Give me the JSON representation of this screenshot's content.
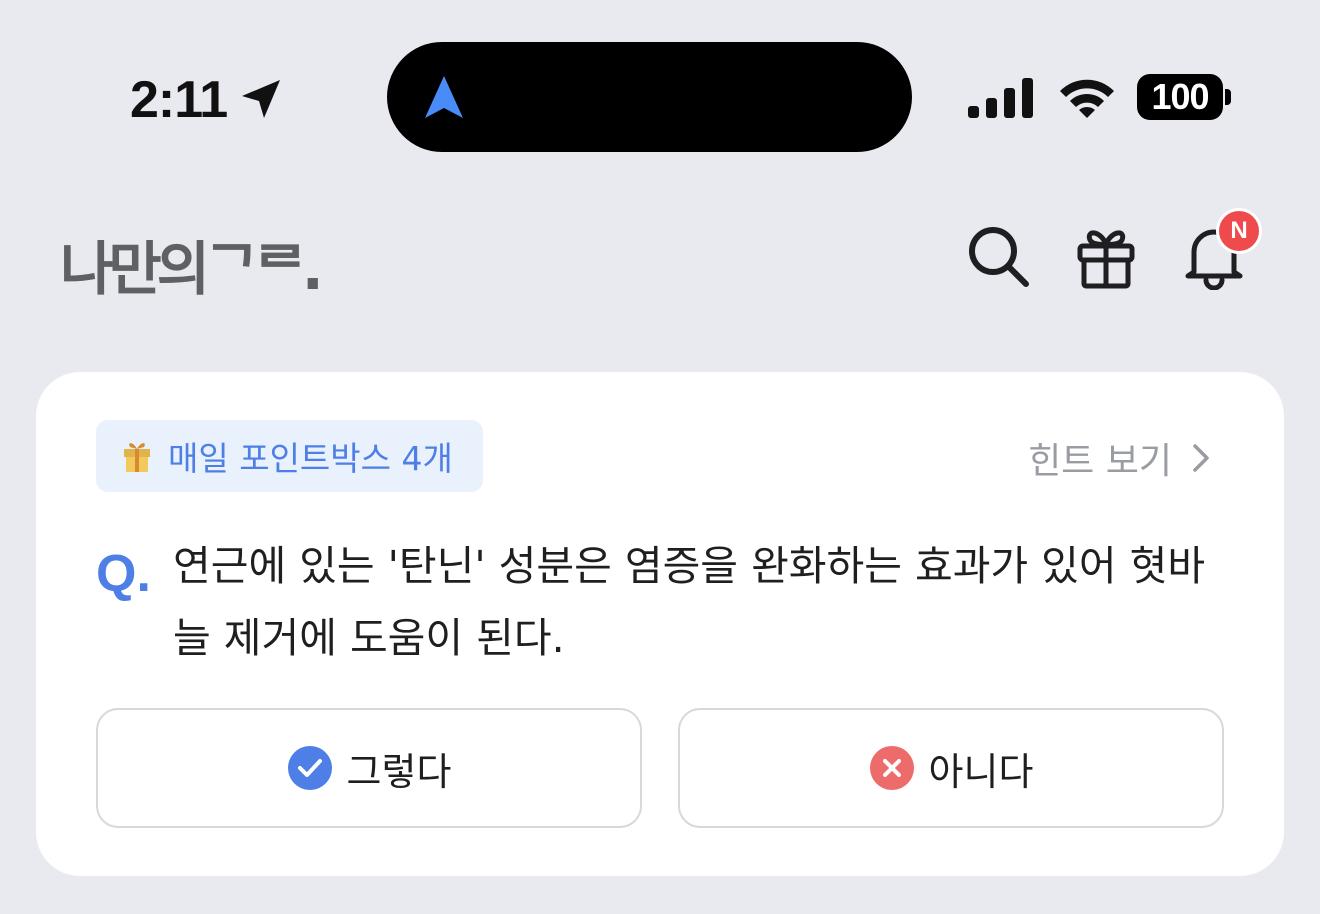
{
  "status_bar": {
    "time": "2:11",
    "battery": "100"
  },
  "header": {
    "logo_text": "나만의ᄀᄅ.",
    "notification_badge": "N"
  },
  "quiz": {
    "pill_label": "매일 포인트박스 4개",
    "hint_label": "힌트 보기",
    "q_mark": "Q.",
    "question": "연근에 있는 '탄닌' 성분은 염증을 완화하는 효과가 있어 혓바늘 제거에 도움이 된다.",
    "yes_label": "그렇다",
    "no_label": "아니다"
  },
  "colors": {
    "background": "#e9eaef",
    "accent_blue": "#4d7fe6",
    "badge_red": "#ef4b4f",
    "no_red": "#ee6b6b"
  }
}
